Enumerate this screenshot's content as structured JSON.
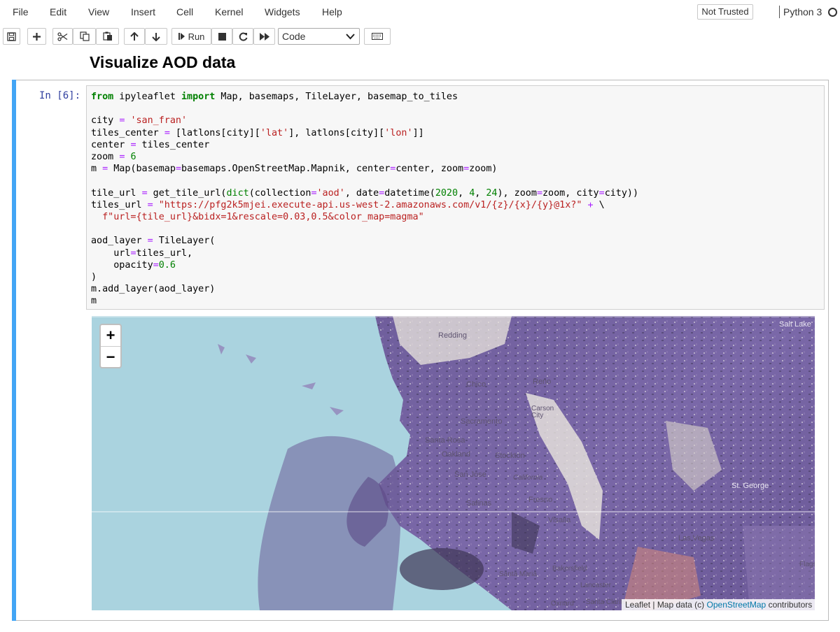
{
  "menu": {
    "items": [
      "File",
      "Edit",
      "View",
      "Insert",
      "Cell",
      "Kernel",
      "Widgets",
      "Help"
    ],
    "trusted_label": "Not Trusted",
    "kernel_name": "Python 3"
  },
  "toolbar": {
    "run_label": "Run",
    "cell_type": "Code",
    "icons": [
      "save-icon",
      "plus-icon",
      "scissors-icon",
      "copy-icon",
      "paste-icon",
      "arrow-up-icon",
      "arrow-down-icon",
      "step-forward-icon",
      "stop-icon",
      "restart-icon",
      "fast-forward-icon",
      "keyboard-icon"
    ]
  },
  "notebook": {
    "heading": "Visualize AOD data",
    "cell": {
      "prompt": "In [6]:",
      "code_lines": [
        "from ipyleaflet import Map, basemaps, TileLayer, basemap_to_tiles",
        "",
        "city = 'san_fran'",
        "tiles_center = [latlons[city]['lat'], latlons[city]['lon']]",
        "center = tiles_center",
        "zoom = 6",
        "m = Map(basemap=basemaps.OpenStreetMap.Mapnik, center=center, zoom=zoom)",
        "",
        "tile_url = get_tile_url(dict(collection='aod', date=datetime(2020, 4, 24), zoom=zoom, city=city))",
        "tiles_url = \"https://pfg2k5mjei.execute-api.us-west-2.amazonaws.com/v1/{z}/{x}/{y}@1x?\" + \\",
        "  f\"url={tile_url}&bidx=1&rescale=0.03,0.5&color_map=magma\"",
        "",
        "aod_layer = TileLayer(",
        "    url=tiles_url,",
        "    opacity=0.6",
        ")",
        "m.add_layer(aod_layer)",
        "m"
      ]
    }
  },
  "map": {
    "zoom_in": "+",
    "zoom_out": "−",
    "attribution_prefix": "Leaflet | Map data (c) ",
    "attribution_link": "OpenStreetMap",
    "attribution_suffix": " contributors",
    "places": [
      "Redding",
      "Chico",
      "Reno",
      "Carson City",
      "Sacramento",
      "Santa Rosa",
      "Oakland",
      "Stockton",
      "San Jose",
      "California",
      "Fresno",
      "Salinas",
      "Visalia",
      "Las Vegas",
      "St. George",
      "Salt Lake",
      "Bakersfield",
      "Santa Maria",
      "Lancaster",
      "Oxnard",
      "Santa Clarita",
      "Flagstaff"
    ],
    "colors": {
      "ocean": "#aad3df",
      "land": "#e8e4dc",
      "aod_purple": "#5b4a86",
      "aod_dark": "#3e3655",
      "aod_light": "#8e79b4",
      "aod_orange": "#d98a7a"
    }
  }
}
